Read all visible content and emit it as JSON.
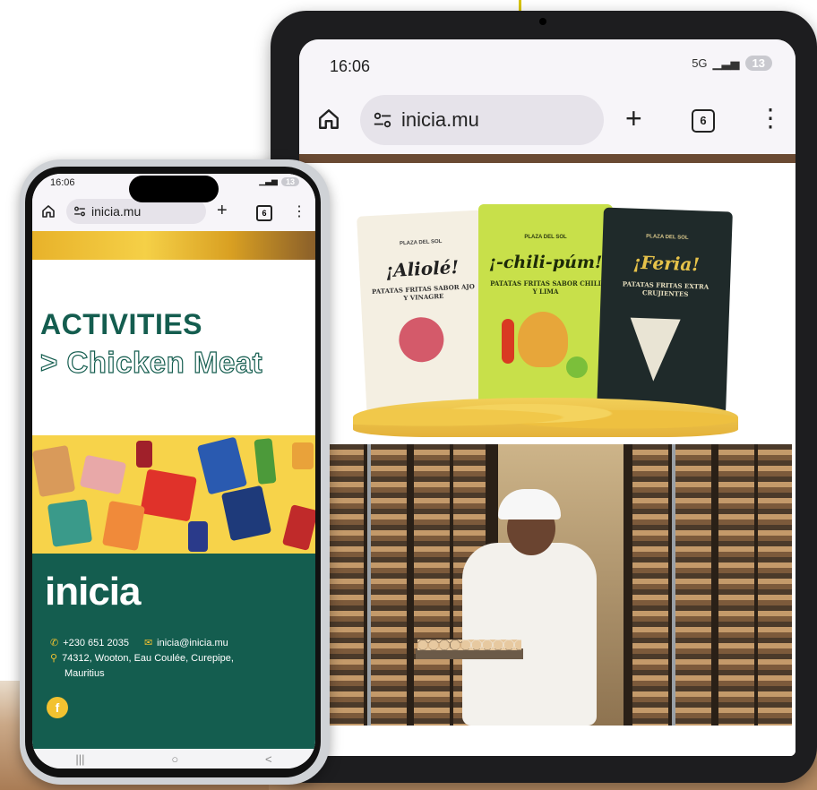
{
  "tablet": {
    "status_time": "16:06",
    "signal_label": "5G",
    "notification_count": "13",
    "url": "inicia.mu",
    "tab_count": "6",
    "menu_glyph": "⋮",
    "plus_glyph": "+"
  },
  "chips": {
    "bags": [
      {
        "brand": "PLAZA DEL SOL",
        "title": "¡Aliolé!",
        "subtitle": "PATATAS FRITAS SABOR AJO Y VINAGRE",
        "color": "#f4efe2"
      },
      {
        "brand": "PLAZA DEL SOL",
        "title": "¡-chili-púm!",
        "subtitle": "PATATAS FRITAS SABOR CHILI Y LIMA",
        "color": "#c8e04a"
      },
      {
        "brand": "PLAZA DEL SOL",
        "title": "¡Feria!",
        "subtitle": "PATATAS FRITAS EXTRA CRUJIENTES",
        "color": "#1f2a2a"
      }
    ]
  },
  "phone": {
    "status_time": "16:06",
    "notification_count": "13",
    "url": "inicia.mu",
    "tab_count": "6",
    "plus_glyph": "+",
    "menu_glyph": "⋮",
    "heading": "ACTIVITIES",
    "subheading": "> Chicken Meat",
    "logo": "inicia",
    "phone_number": "+230 651 2035",
    "email": "inicia@inicia.mu",
    "address_line1": "74312, Wooton, Eau Coulée, Curepipe,",
    "address_line2": "Mauritius",
    "nav": {
      "recent": "|||",
      "home": "○",
      "back": "<"
    }
  },
  "colors": {
    "brand_green": "#145d4f",
    "accent_yellow": "#f2c230"
  }
}
